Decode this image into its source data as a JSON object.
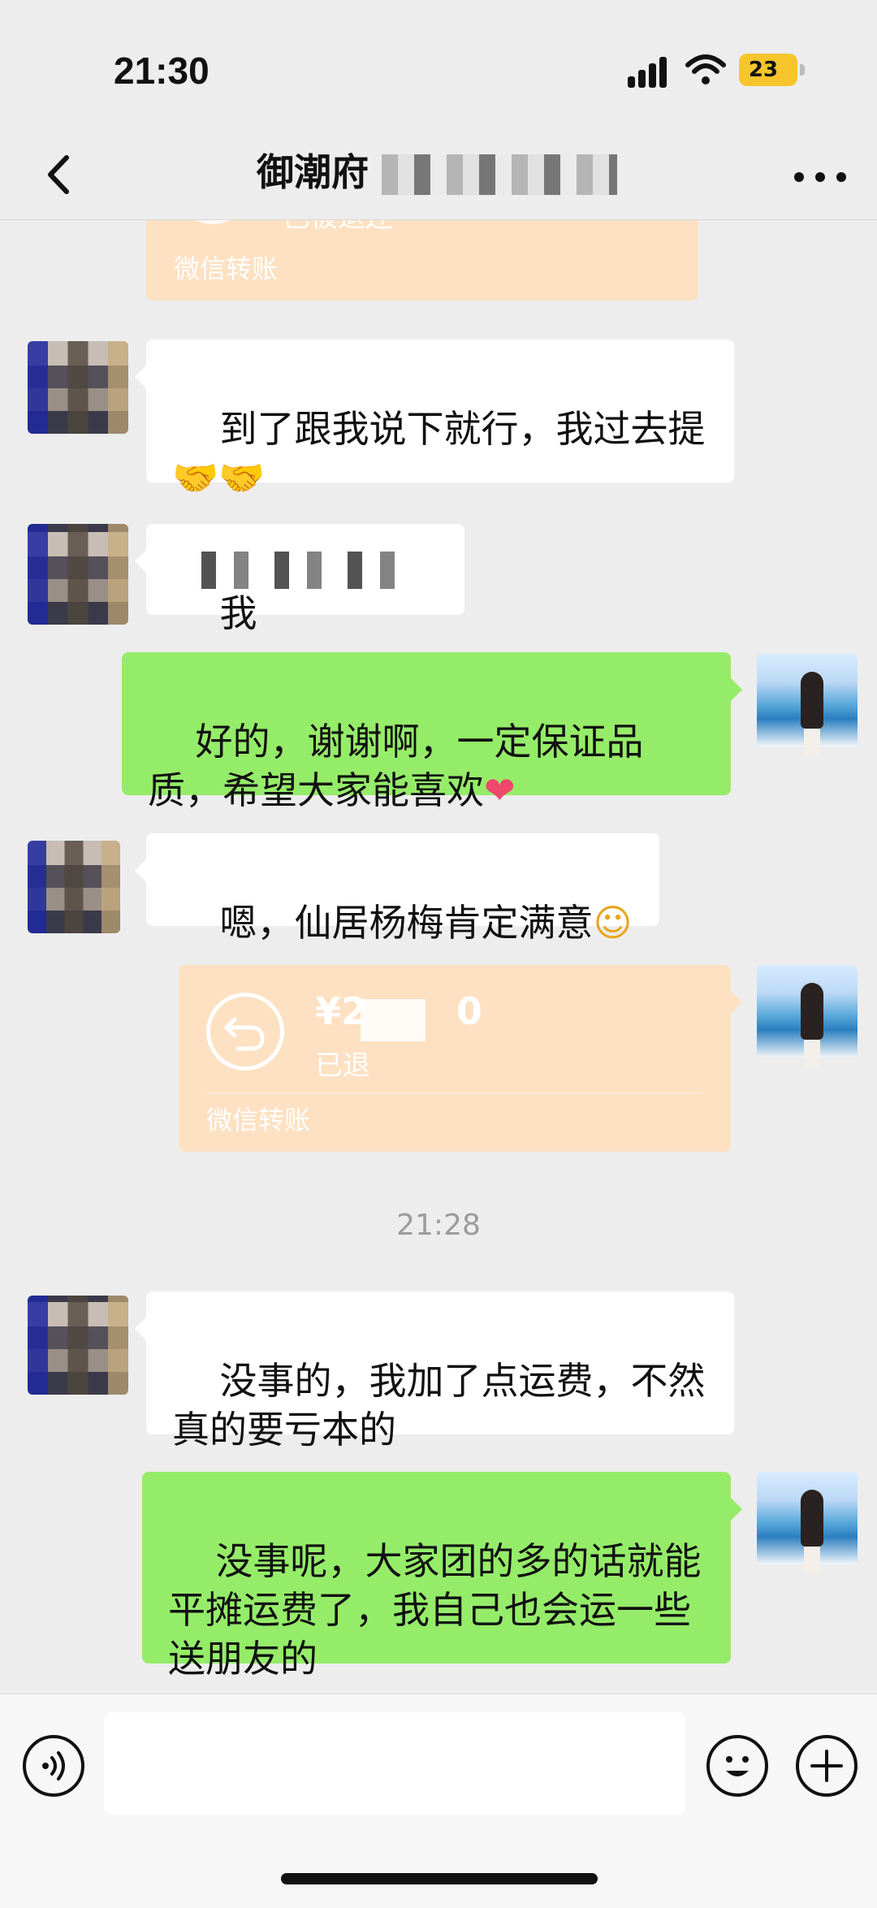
{
  "status_bar": {
    "time": "21:30",
    "battery": "23"
  },
  "nav": {
    "title": "御潮府"
  },
  "messages": {
    "transfer_top": {
      "status": "已被退还",
      "footer": "微信转账"
    },
    "m1": {
      "text": "到了跟我说下就行，我过去提",
      "emoji": "🤝🤝"
    },
    "m2": {
      "text": "我"
    },
    "m3": {
      "text": "好的，谢谢啊，一定保证品质，希望大家能喜欢",
      "emoji": "❤"
    },
    "m4": {
      "text": "嗯，仙居杨梅肯定满意",
      "emoji": "☺"
    },
    "transfer": {
      "amount": "¥2",
      "amount_tail": "0",
      "status": "已退",
      "footer": "微信转账"
    },
    "timestamp": "21:28",
    "m5": {
      "text": "没事的，我加了点运费，不然真的要亏本的"
    },
    "m6": {
      "text": "没事呢，大家团的多的话就能平摊运费了，我自己也会运一些送朋友的"
    }
  },
  "input_bar": {
    "value": "",
    "placeholder": ""
  },
  "icons": {
    "back": "chevron-left-icon",
    "more": "more-dots-icon",
    "voice": "voice-icon",
    "emoji": "emoji-face-icon",
    "plus": "plus-icon",
    "transfer": "return-arrow-icon"
  },
  "colors": {
    "background": "#ededed",
    "outgoing_bubble": "#95ec69",
    "incoming_bubble": "#ffffff",
    "transfer_card": "#fde1c2",
    "battery": "#f5c52b"
  }
}
